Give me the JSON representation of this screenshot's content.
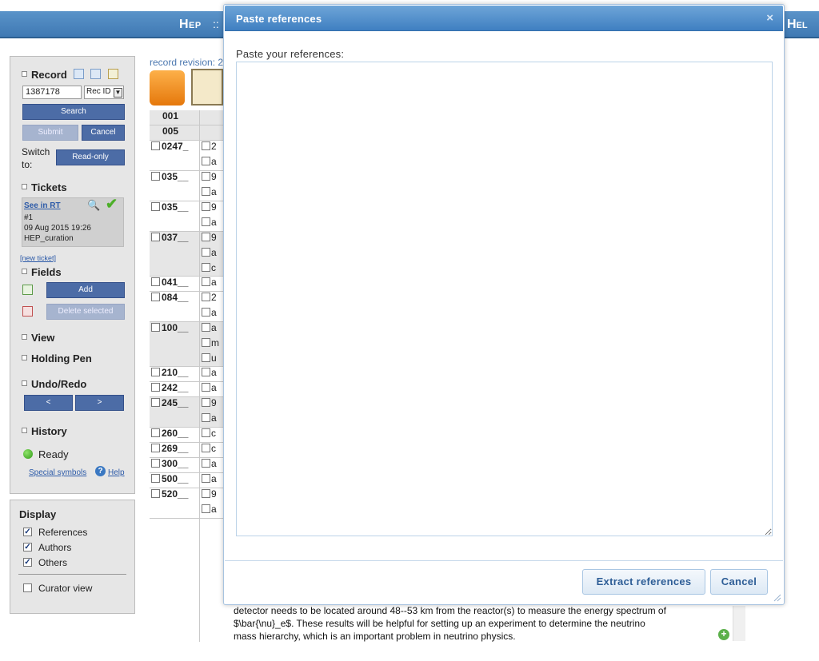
{
  "header": {
    "nav_left": "Hep",
    "nav_separator": "::",
    "nav_right_partial": "Hel"
  },
  "record": {
    "title": "Record",
    "recid_value": "1387178",
    "recid_type": "Rec ID",
    "search_label": "Search",
    "submit_label": "Submit",
    "cancel_label": "Cancel",
    "switch_to_label": "Switch to:",
    "readonly_label": "Read-only",
    "revision_label": "record revision: 2"
  },
  "tickets": {
    "title": "Tickets",
    "see_in_rt": "See in RT",
    "number": "#1",
    "date": "09 Aug 2015 19:26",
    "queue": "HEP_curation",
    "new_ticket": "[new ticket]"
  },
  "fields": {
    "title": "Fields",
    "add_label": "Add",
    "delete_label": "Delete selected"
  },
  "sections": {
    "view": "View",
    "holding_pen": "Holding Pen",
    "undo_redo": "Undo/Redo",
    "undo_btn": "<",
    "redo_btn": ">",
    "history": "History",
    "status": "Ready",
    "special_symbols": "Special symbols",
    "help": "Help"
  },
  "display": {
    "title": "Display",
    "options": [
      {
        "label": "References",
        "checked": true
      },
      {
        "label": "Authors",
        "checked": true
      },
      {
        "label": "Others",
        "checked": true
      }
    ],
    "curator_view": "Curator view"
  },
  "record_fields": [
    {
      "tag": "001",
      "subfields": [],
      "checkbox": false
    },
    {
      "tag": "005",
      "subfields": [],
      "checkbox": false
    },
    {
      "tag": "0247_",
      "subfields": [
        "2",
        "a"
      ],
      "checkbox": true
    },
    {
      "tag": "035__",
      "subfields": [
        "9",
        "a"
      ],
      "checkbox": true
    },
    {
      "tag": "035__",
      "subfields": [
        "9",
        "a"
      ],
      "checkbox": true
    },
    {
      "tag": "037__",
      "subfields": [
        "9",
        "a",
        "c"
      ],
      "checkbox": true
    },
    {
      "tag": "041__",
      "subfields": [
        "a"
      ],
      "checkbox": true
    },
    {
      "tag": "084__",
      "subfields": [
        "2",
        "a"
      ],
      "checkbox": true
    },
    {
      "tag": "100__",
      "subfields": [
        "a",
        "m",
        "u"
      ],
      "checkbox": true
    },
    {
      "tag": "210__",
      "subfields": [
        "a"
      ],
      "checkbox": true
    },
    {
      "tag": "242__",
      "subfields": [
        "a"
      ],
      "checkbox": true
    },
    {
      "tag": "245__",
      "subfields": [
        "9",
        "a"
      ],
      "checkbox": true
    },
    {
      "tag": "260__",
      "subfields": [
        "c"
      ],
      "checkbox": true
    },
    {
      "tag": "269__",
      "subfields": [
        "c"
      ],
      "checkbox": true
    },
    {
      "tag": "300__",
      "subfields": [
        "a"
      ],
      "checkbox": true
    },
    {
      "tag": "500__",
      "subfields": [
        "a"
      ],
      "checkbox": true
    },
    {
      "tag": "520__",
      "subfields": [
        "9",
        "a"
      ],
      "checkbox": true
    }
  ],
  "abstract_lines": [
    "detector needs to be located around 48--53 km from the reactor(s) to measure the energy spectrum of",
    "$\\bar{\\nu}_e$. These results will be helpful for setting up an experiment to determine the neutrino",
    "mass hierarchy, which is an important problem in neutrino physics."
  ],
  "dialog": {
    "title": "Paste references",
    "close_glyph": "×",
    "prompt": "Paste your references:",
    "textarea_value": "",
    "extract_label": "Extract references",
    "cancel_label": "Cancel"
  },
  "colors": {
    "header_blue": "#3f79b3",
    "button_blue": "#4c6ca6",
    "dialog_title_blue": "#3f7fc1",
    "ready_green": "#2f9a16"
  }
}
